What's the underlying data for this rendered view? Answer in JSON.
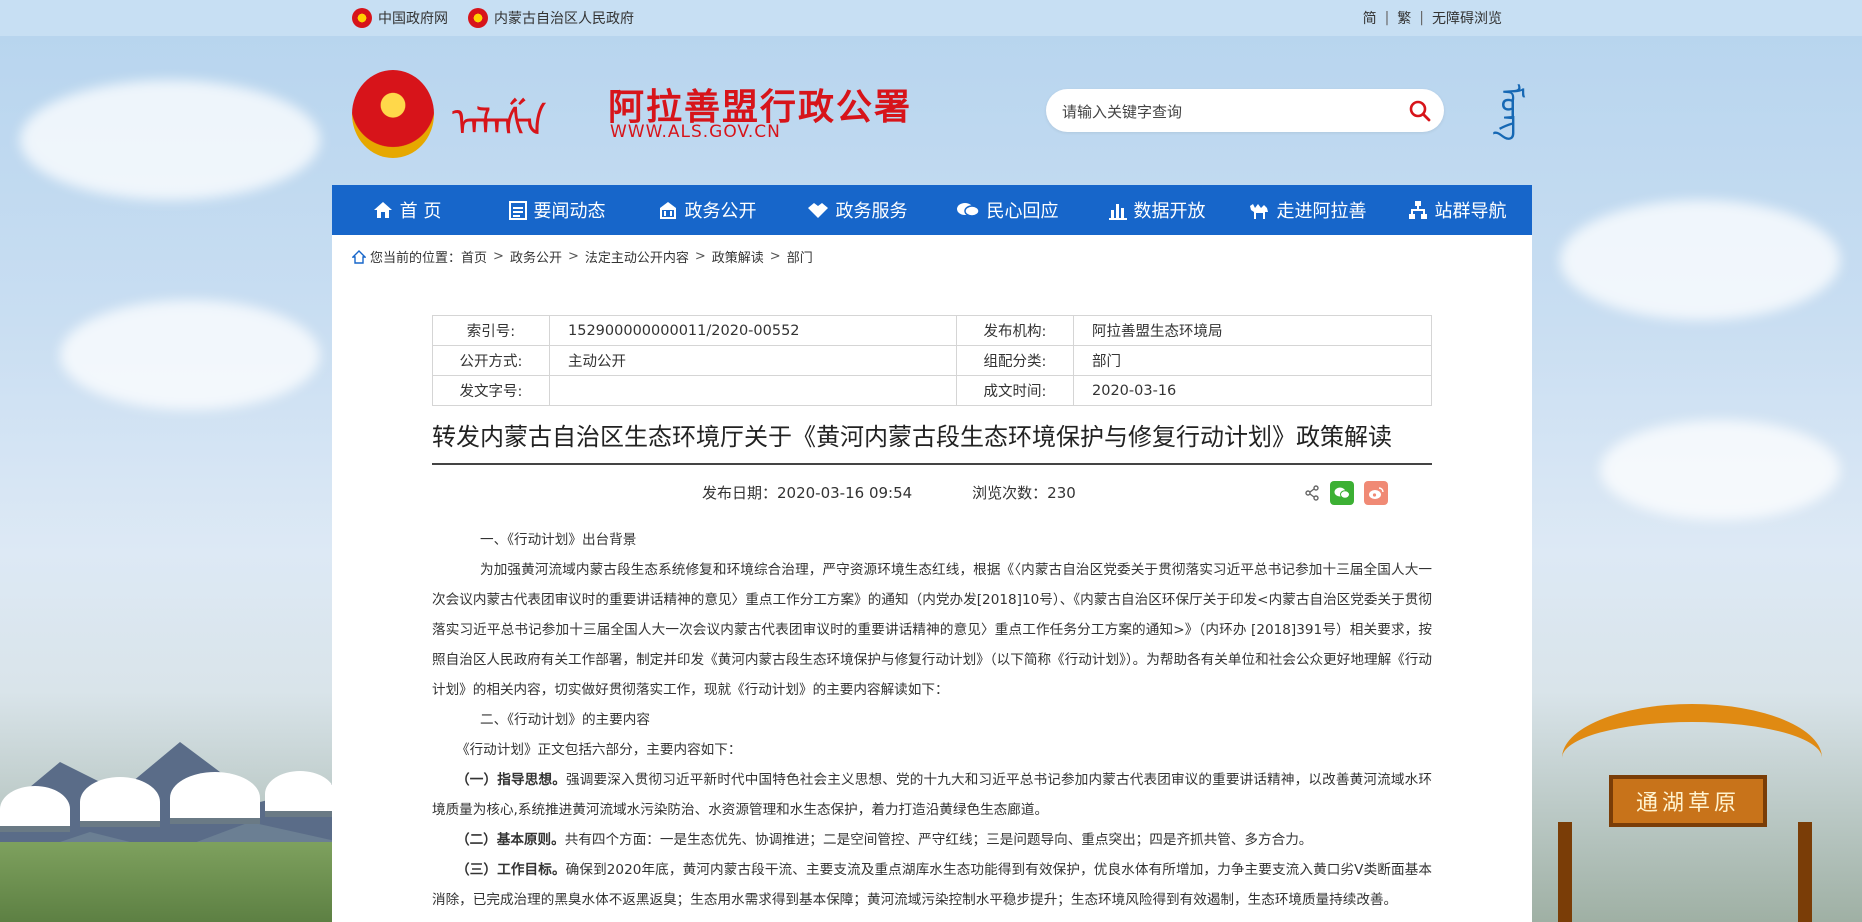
{
  "topbar": {
    "links": [
      "中国政府网",
      "内蒙古自治区人民政府"
    ],
    "right": [
      "简",
      "繁",
      "无障碍浏览"
    ]
  },
  "header": {
    "mongol_script": "ᠠᠯᠠᠱᠠ",
    "title": "阿拉善盟行政公署",
    "url": "WWW.ALS.GOV.CN",
    "search_placeholder": "请输入关键字查询",
    "mongol_lang": "ᠮᠣᠩ"
  },
  "nav": [
    "首 页",
    "要闻动态",
    "政务公开",
    "政务服务",
    "民心回应",
    "数据开放",
    "走进阿拉善",
    "站群导航"
  ],
  "breadcrumb": {
    "prefix": "您当前的位置：",
    "items": [
      "首页",
      "政务公开",
      "法定主动公开内容",
      "政策解读",
      "部门"
    ]
  },
  "meta": {
    "index_label": "索引号:",
    "index_value": "152900000000011/2020-00552",
    "publisher_label": "发布机构:",
    "publisher_value": "阿拉善盟生态环境局",
    "method_label": "公开方式:",
    "method_value": "主动公开",
    "category_label": "组配分类:",
    "category_value": "部门",
    "docno_label": "发文字号:",
    "docno_value": "",
    "date_label": "成文时间:",
    "date_value": "2020-03-16"
  },
  "article": {
    "title": "转发内蒙古自治区生态环境厅关于《黄河内蒙古段生态环境保护与修复行动计划》政策解读",
    "pub_date": "发布日期：2020-03-16 09:54",
    "views": "浏览次数：230",
    "p1": "一、《行动计划》出台背景",
    "p2": "为加强黄河流域内蒙古段生态系统修复和环境综合治理，严守资源环境生态红线，根据《〈内蒙古自治区党委关于贯彻落实习近平总书记参加十三届全国人大一次会议内蒙古代表团审议时的重要讲话精神的意见〉重点工作分工方案》的通知（内党办发[2018]10号）、《内蒙古自治区环保厅关于印发<内蒙古自治区党委关于贯彻落实习近平总书记参加十三届全国人大一次会议内蒙古代表团审议时的重要讲话精神的意见〉重点工作任务分工方案的通知>》（内环办 [2018]391号）相关要求，按照自治区人民政府有关工作部署，制定并印发《黄河内蒙古段生态环境保护与修复行动计划》（以下简称《行动计划》）。为帮助各有关单位和社会公众更好地理解《行动计划》的相关内容，切实做好贯彻落实工作，现就《行动计划》的主要内容解读如下：",
    "p3": "二、《行动计划》的主要内容",
    "p4": "《行动计划》正文包括六部分，主要内容如下：",
    "p5_head": "（一）指导思想。",
    "p5": "强调要深入贯彻习近平新时代中国特色社会主义思想、党的十九大和习近平总书记参加内蒙古代表团审议的重要讲话精神，以改善黄河流域水环境质量为核心,系统推进黄河流域水污染防治、水资源管理和水生态保护，着力打造沿黄绿色生态廊道。",
    "p6_head": "（二）基本原则。",
    "p6": "共有四个方面：一是生态优先、协调推进；二是空间管控、严守红线；三是问题导向、重点突出；四是齐抓共管、多方合力。",
    "p7_head": "（三）工作目标。",
    "p7": "确保到2020年底，黄河内蒙古段干流、主要支流及重点湖库水生态功能得到有效保护，优良水体有所增加，力争主要支流入黄口劣Ⅴ类断面基本消除，已完成治理的黑臭水体不返黑返臭；生态用水需求得到基本保障；黄河流域污染控制水平稳步提升；生态环境风险得到有效遏制，生态环境质量持续改善。"
  },
  "decor": {
    "gate_sign": "通湖草原"
  }
}
